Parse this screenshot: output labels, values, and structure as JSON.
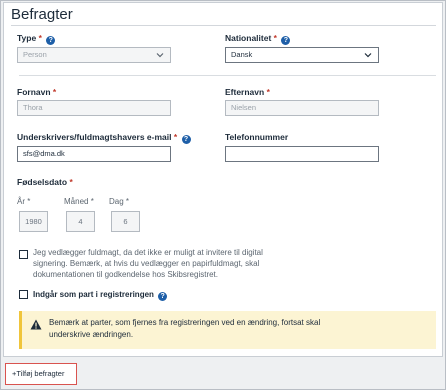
{
  "section": {
    "title": "Befragter"
  },
  "fields": {
    "type": {
      "label": "Type",
      "value": "Person"
    },
    "nationality": {
      "label": "Nationalitet",
      "value": "Dansk"
    },
    "first_name": {
      "label": "Fornavn",
      "value": "Thora"
    },
    "last_name": {
      "label": "Efternavn",
      "value": "Nielsen"
    },
    "email": {
      "label": "Underskrivers/fuldmagtshavers e-mail",
      "value": "sfs@dma.dk"
    },
    "phone": {
      "label": "Telefonnummer",
      "value": ""
    },
    "birthdate": {
      "label": "Fødselsdato",
      "year_label": "År",
      "year_value": "1980",
      "month_label": "Måned",
      "month_value": "4",
      "day_label": "Dag",
      "day_value": "6"
    }
  },
  "required_mark": "*",
  "help_glyph": "?",
  "checkboxes": {
    "power_of_attorney": {
      "line1": "Jeg vedlægger fuldmagt, da det ikke er muligt at invitere til digital",
      "line2": "signering. Bemærk, at hvis du vedlægger en papirfuldmagt, skal",
      "line3": "dokumentationen til godkendelse hos Skibsregistret.",
      "checked": false
    },
    "party": {
      "label": "Indgår som part i registreringen",
      "checked": false
    }
  },
  "warning": {
    "line1": "Bemærk at parter, som fjernes fra registreringen ved en ændring, fortsat skal",
    "line2": "underskrive ændringen."
  },
  "add_button": {
    "label": "+Tilføj befragter"
  },
  "colors": {
    "accent": "#1e5fa8",
    "required": "#c0392b",
    "warning_bg": "#fcf4d3",
    "warning_border": "#f0c53b",
    "highlight": "#d9534f"
  }
}
